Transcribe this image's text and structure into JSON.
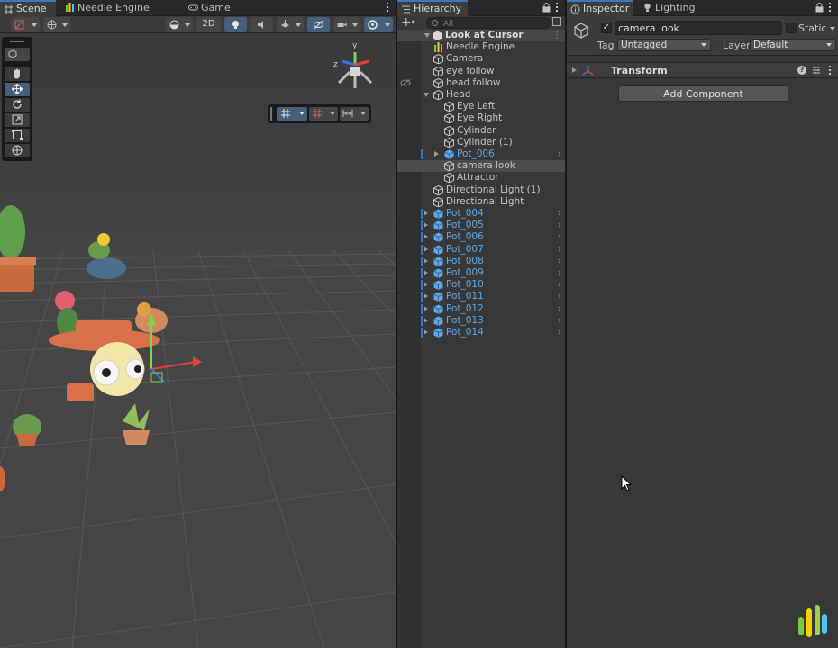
{
  "scene_panel": {
    "tabs": [
      {
        "label": "Scene",
        "icon": "scene-grid-icon",
        "active": true
      },
      {
        "label": "Needle Engine Publish",
        "icon": "needle-cactus-icon",
        "active": false
      },
      {
        "label": "Game",
        "icon": "gamepad-icon",
        "active": false
      }
    ],
    "toolbar": {
      "mode_2d_label": "2D"
    }
  },
  "hierarchy": {
    "tab_label": "Hierarchy",
    "search_placeholder": "All",
    "scene_name": "Look at Cursor",
    "items": [
      {
        "label": "Needle Engine",
        "depth": 1,
        "prefab": false,
        "fold": "none",
        "icon": "needle-cactus-icon"
      },
      {
        "label": "Camera",
        "depth": 1,
        "prefab": false,
        "fold": "none",
        "icon": "gameobject-cube-icon"
      },
      {
        "label": "eye follow",
        "depth": 1,
        "prefab": false,
        "fold": "none",
        "icon": "gameobject-cube-icon"
      },
      {
        "label": "head follow",
        "depth": 1,
        "prefab": false,
        "fold": "none",
        "icon": "gameobject-cube-icon",
        "hidden": true
      },
      {
        "label": "Head",
        "depth": 1,
        "prefab": false,
        "fold": "open",
        "icon": "gameobject-cube-icon"
      },
      {
        "label": "Eye Left",
        "depth": 2,
        "prefab": false,
        "fold": "none",
        "icon": "gameobject-cube-icon"
      },
      {
        "label": "Eye Right",
        "depth": 2,
        "prefab": false,
        "fold": "none",
        "icon": "gameobject-cube-icon"
      },
      {
        "label": "Cylinder",
        "depth": 2,
        "prefab": false,
        "fold": "none",
        "icon": "gameobject-cube-icon"
      },
      {
        "label": "Cylinder (1)",
        "depth": 2,
        "prefab": false,
        "fold": "none",
        "icon": "gameobject-cube-icon"
      },
      {
        "label": "Pot_006",
        "depth": 2,
        "prefab": true,
        "fold": "closed",
        "icon": "prefab-cube-icon",
        "overridden": true
      },
      {
        "label": "camera look",
        "depth": 2,
        "prefab": false,
        "fold": "none",
        "icon": "gameobject-cube-icon",
        "selected": true
      },
      {
        "label": "Attractor",
        "depth": 2,
        "prefab": false,
        "fold": "none",
        "icon": "gameobject-cube-icon"
      },
      {
        "label": "Directional Light (1)",
        "depth": 1,
        "prefab": false,
        "fold": "none",
        "icon": "gameobject-cube-icon"
      },
      {
        "label": "Directional Light",
        "depth": 1,
        "prefab": false,
        "fold": "none",
        "icon": "gameobject-cube-icon"
      },
      {
        "label": "Pot_004",
        "depth": 1,
        "prefab": true,
        "fold": "closed",
        "icon": "prefab-cube-icon",
        "overridden": true
      },
      {
        "label": "Pot_005",
        "depth": 1,
        "prefab": true,
        "fold": "closed",
        "icon": "prefab-cube-icon",
        "overridden": true
      },
      {
        "label": "Pot_006",
        "depth": 1,
        "prefab": true,
        "fold": "closed",
        "icon": "prefab-cube-icon",
        "overridden": true
      },
      {
        "label": "Pot_007",
        "depth": 1,
        "prefab": true,
        "fold": "closed",
        "icon": "prefab-cube-icon",
        "overridden": true
      },
      {
        "label": "Pot_008",
        "depth": 1,
        "prefab": true,
        "fold": "closed",
        "icon": "prefab-cube-icon",
        "overridden": true
      },
      {
        "label": "Pot_009",
        "depth": 1,
        "prefab": true,
        "fold": "closed",
        "icon": "prefab-cube-icon",
        "overridden": true
      },
      {
        "label": "Pot_010",
        "depth": 1,
        "prefab": true,
        "fold": "closed",
        "icon": "prefab-cube-icon",
        "overridden": true
      },
      {
        "label": "Pot_011",
        "depth": 1,
        "prefab": true,
        "fold": "closed",
        "icon": "prefab-cube-icon",
        "overridden": true
      },
      {
        "label": "Pot_012",
        "depth": 1,
        "prefab": true,
        "fold": "closed",
        "icon": "prefab-cube-icon",
        "overridden": true
      },
      {
        "label": "Pot_013",
        "depth": 1,
        "prefab": true,
        "fold": "closed",
        "icon": "prefab-cube-icon",
        "overridden": true
      },
      {
        "label": "Pot_014",
        "depth": 1,
        "prefab": true,
        "fold": "closed",
        "icon": "prefab-cube-icon",
        "overridden": true
      }
    ]
  },
  "inspector": {
    "tabs": [
      {
        "label": "Inspector",
        "icon": "info-icon",
        "active": true
      },
      {
        "label": "Lighting",
        "icon": "lightbulb-icon",
        "active": false
      }
    ],
    "object_name": "camera look",
    "active": true,
    "static_label": "Static",
    "tag_label": "Tag",
    "tag_value": "Untagged",
    "layer_label": "Layer",
    "layer_value": "Default",
    "component_title": "Transform",
    "add_component_label": "Add Component"
  },
  "colors": {
    "accent_blue": "#3a79bb",
    "prefab_text": "#5ea8e6",
    "panel_bg": "#383838",
    "viewport_bg": "#444444"
  }
}
